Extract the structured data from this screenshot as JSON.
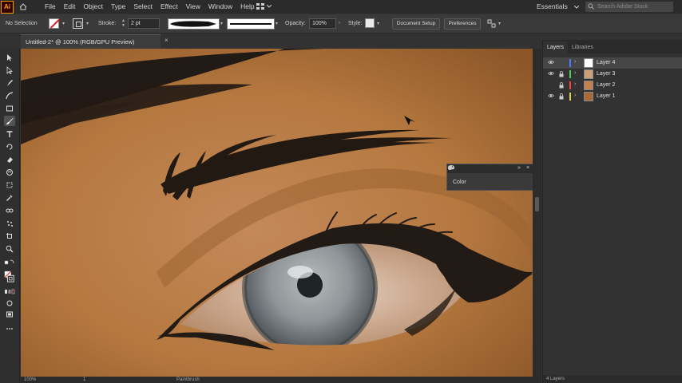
{
  "app": {
    "logo_text": "Ai"
  },
  "menu": {
    "items": [
      "File",
      "Edit",
      "Object",
      "Type",
      "Select",
      "Effect",
      "View",
      "Window",
      "Help"
    ],
    "workspace": "Essentials",
    "search_placeholder": "Search Adobe Stock"
  },
  "control": {
    "selection": "No Selection",
    "stroke_label": "Stroke:",
    "stroke_value": "2 pt",
    "opacity_label": "Opacity:",
    "opacity_value": "100%",
    "style_label": "Style:",
    "document_setup": "Document Setup",
    "preferences": "Preferences"
  },
  "document": {
    "tab_title": "Untitled-2* @ 100% (RGB/GPU Preview)",
    "close_glyph": "×"
  },
  "status": {
    "zoom": "100%",
    "page": "1",
    "tool": "Paintbrush"
  },
  "color_panel": {
    "title": "Color"
  },
  "layers_panel": {
    "tabs": [
      "Layers",
      "Libraries"
    ],
    "layers": [
      {
        "name": "Layer 4",
        "color": "#4f7cff"
      },
      {
        "name": "Layer 3",
        "color": "#4fd04f"
      },
      {
        "name": "Layer 2",
        "color": "#ff4040"
      },
      {
        "name": "Layer 1",
        "color": "#e2d24f"
      }
    ],
    "footer": "4 Layers"
  },
  "colors": {
    "accent": "#ff9a00",
    "skin": "#b8804a",
    "ink": "#221a14"
  }
}
